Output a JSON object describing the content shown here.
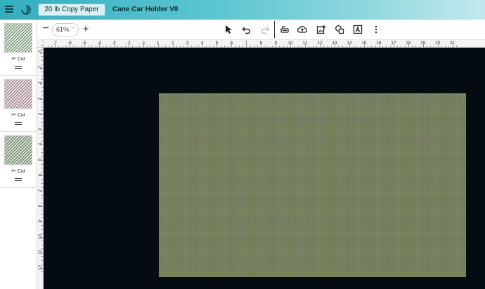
{
  "header": {
    "material_button": "20 lb Copy Paper",
    "project_title": "Cane Car Holder V8"
  },
  "layers": [
    {
      "label": "Cut",
      "color": "#5e7d5e"
    },
    {
      "label": "Cut",
      "color": "#8a6a78"
    },
    {
      "label": "Cut",
      "color": "#4d6b4d"
    }
  ],
  "toolbar": {
    "zoom_minus": "−",
    "zoom_value": "61%",
    "zoom_plus": "+",
    "tools": [
      "select-icon",
      "undo-icon",
      "redo-icon",
      "blade-icon",
      "cloud-upload-icon",
      "add-image-icon",
      "shapes-icon",
      "text-icon",
      "more-icon"
    ]
  },
  "ruler": {
    "top_labels": [
      "-7",
      "-6",
      "-5",
      "-4",
      "-3",
      "-2",
      "-1",
      "1",
      "2",
      "3",
      "4",
      "5",
      "6",
      "7",
      "8",
      "9",
      "10",
      "11",
      "12",
      "13",
      "14",
      "15",
      "16",
      "17",
      "18",
      "19",
      "20",
      "21"
    ],
    "left_labels": [
      "-3",
      "-2",
      "-1",
      "1",
      "2",
      "3",
      "4",
      "5",
      "6",
      "7",
      "8",
      "9",
      "10",
      "11",
      "12"
    ]
  },
  "canvas": {
    "background": "#040c11",
    "sheet_color": "#6f7d52"
  }
}
